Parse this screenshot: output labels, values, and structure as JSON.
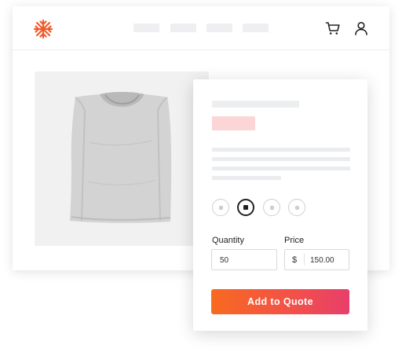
{
  "header": {
    "icons": [
      "snowflake-logo-icon",
      "shopping-cart-icon",
      "user-icon"
    ],
    "nav_placeholder_count": 4
  },
  "product": {
    "image": "folded-gray-t-shirt",
    "options": [
      "option-1",
      "option-2",
      "option-3",
      "option-4"
    ],
    "selected_option_index": 1
  },
  "form": {
    "quantity_label": "Quantity",
    "quantity_value": "50",
    "price_label": "Price",
    "price_currency": "$",
    "price_value": "150.00"
  },
  "cta": {
    "label": "Add to Quote"
  },
  "colors": {
    "brand": "#f15a2b",
    "cta_gradient_start": "#f86a20",
    "cta_gradient_end": "#e83e6a",
    "price_placeholder": "#fcd6d6"
  }
}
